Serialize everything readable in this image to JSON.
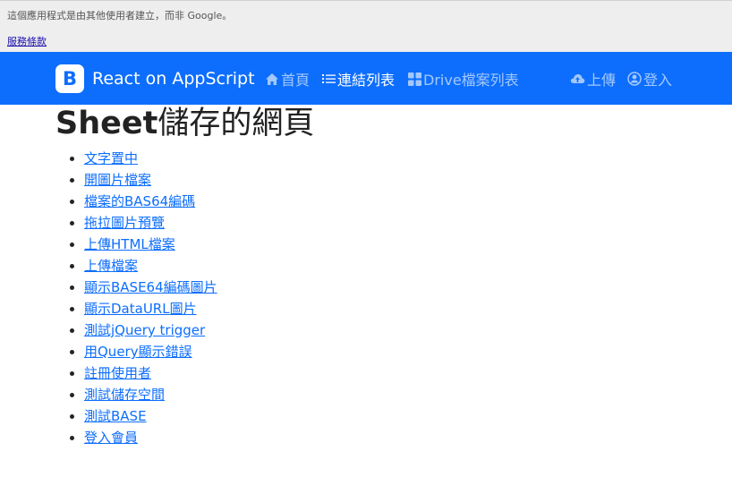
{
  "google_bar": {
    "notice": "這個應用程式是由其他使用者建立，而非 Google。",
    "terms_label": "服務條款"
  },
  "navbar": {
    "brand_letter": "B",
    "brand_name": "React on AppScript",
    "items": [
      {
        "label": "首頁",
        "icon": "home-icon"
      },
      {
        "label": "連結列表",
        "icon": "list-icon"
      },
      {
        "label": "Drive檔案列表",
        "icon": "grid-icon"
      },
      {
        "label": "上傳",
        "icon": "cloud-upload-icon"
      },
      {
        "label": "登入",
        "icon": "user-circle-icon"
      }
    ],
    "accent": "#0d6efd"
  },
  "page": {
    "title_bold": "Sheet",
    "title_rest": "儲存的網頁",
    "links": [
      "文字置中",
      "開圖片檔案",
      "檔案的BAS64編碼",
      "拖拉圖片預覽",
      "上傳HTML檔案",
      "上傳檔案",
      "顯示BASE64編碼圖片",
      "顯示DataURL圖片",
      "測試jQuery trigger",
      "用Query顯示錯誤",
      "註冊使用者",
      "測試儲存空間",
      "測試BASE",
      "登入會員"
    ]
  }
}
